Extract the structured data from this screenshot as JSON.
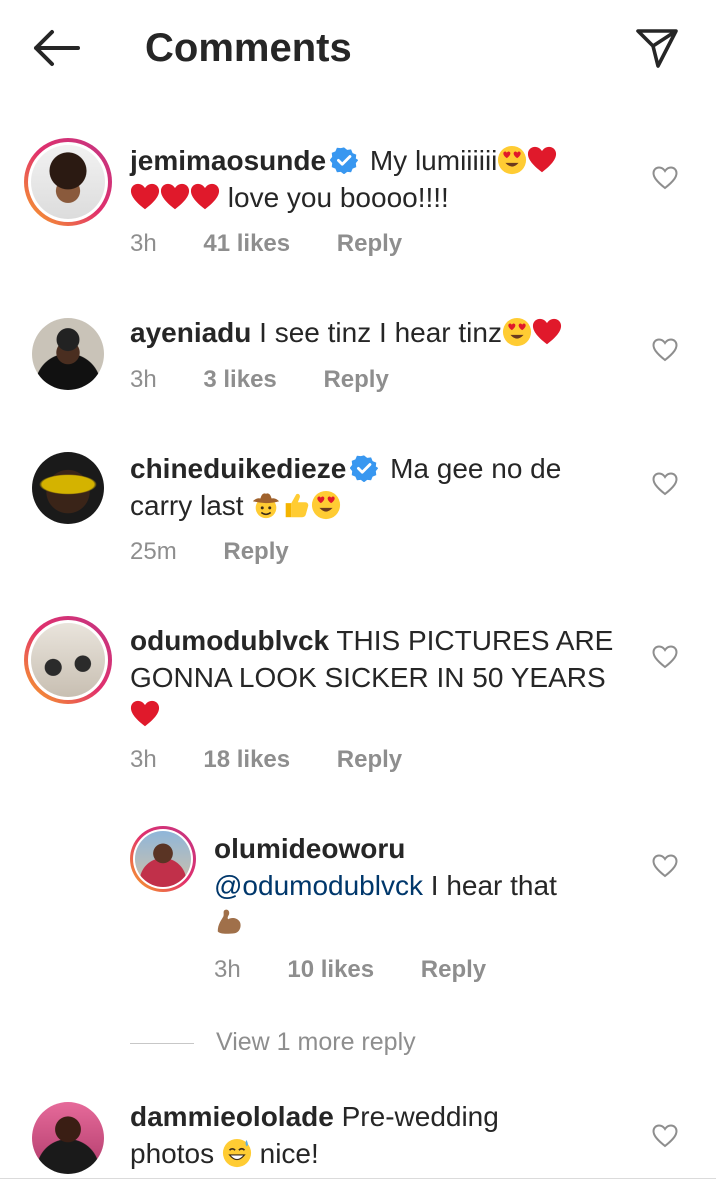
{
  "header": {
    "title": "Comments"
  },
  "comments": [
    {
      "username": "jemimaosunde",
      "verified": true,
      "text": "My lumiiiiii",
      "text2": "love you boooo!!!!",
      "time": "3h",
      "likes": "41 likes",
      "reply": "Reply"
    },
    {
      "username": "ayeniadu",
      "verified": false,
      "text": "I see tinz I hear tinz",
      "time": "3h",
      "likes": "3 likes",
      "reply": "Reply"
    },
    {
      "username": "chineduikedieze",
      "verified": true,
      "text": "Ma gee no de",
      "text2": "carry last",
      "time": "25m",
      "reply": "Reply"
    },
    {
      "username": "odumodublvck",
      "verified": false,
      "text": "THIS PICTURES ARE",
      "text2": "GONNA LOOK SICKER IN 50 YEARS",
      "time": "3h",
      "likes": "18 likes",
      "reply": "Reply"
    },
    {
      "username": "olumideoworu",
      "verified": false,
      "mention": "@odumodublvck",
      "text": "I hear that",
      "time": "3h",
      "likes": "10 likes",
      "reply": "Reply"
    },
    {
      "username": "dammieololade",
      "verified": false,
      "text": "Pre-wedding",
      "text2": "photos",
      "text3": "nice!"
    }
  ],
  "view_more": "View 1 more reply",
  "icons": {
    "back": "arrow-left-icon",
    "send": "paper-plane-icon",
    "like": "heart-outline-icon",
    "verified": "verified-badge-icon"
  },
  "colors": {
    "verified": "#3897f0",
    "mention": "#00376b",
    "meta": "#8e8e8e",
    "heart_emoji": "#e0192b"
  }
}
